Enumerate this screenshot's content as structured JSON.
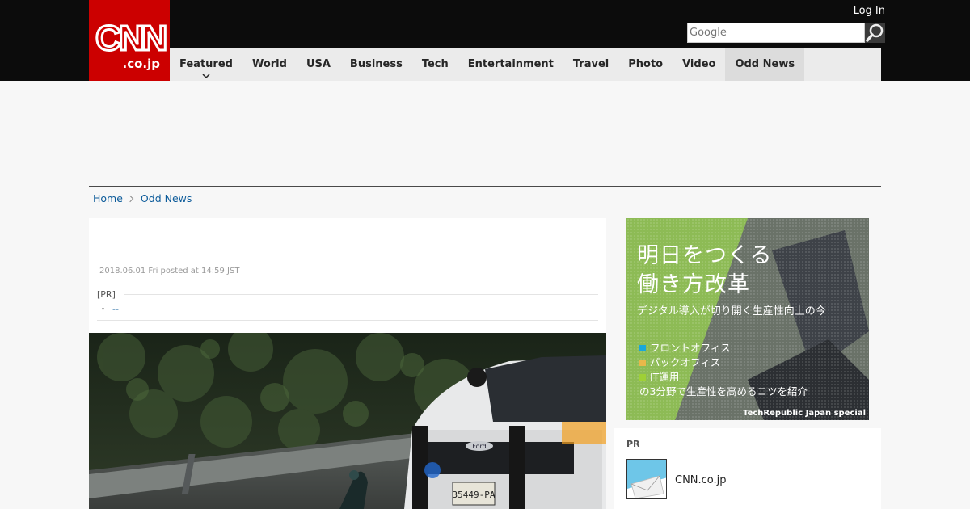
{
  "header": {
    "logo_text": "CNN",
    "logo_sub": ".co.jp",
    "login_label": "Log In",
    "search_placeholder": "Google"
  },
  "nav": {
    "items": [
      {
        "label": "Featured"
      },
      {
        "label": "World"
      },
      {
        "label": "USA"
      },
      {
        "label": "Business"
      },
      {
        "label": "Tech"
      },
      {
        "label": "Entertainment"
      },
      {
        "label": "Travel"
      },
      {
        "label": "Photo"
      },
      {
        "label": "Video"
      },
      {
        "label": "Odd News"
      }
    ],
    "active": "Odd News"
  },
  "breadcrumb": {
    "home": "Home",
    "current": "Odd News"
  },
  "article": {
    "date": "2018.06.01 Fri posted at 14:59 JST",
    "pr_label": "[PR]",
    "pr_bullet": "・",
    "pr_link": "--"
  },
  "ad": {
    "title_line1": "明日をつくる",
    "title_line2": "働き方改革",
    "subtitle": "デジタル導入が切り開く生産性向上の今",
    "list": [
      "フロントオフィス",
      "バックオフィス",
      "IT運用"
    ],
    "list_footer": "の3分野で生産性を高めるコツを紹介",
    "credit": "TechRepublic Japan special",
    "colors": {
      "bg": "#8dbb55",
      "sq1": "#1aa7d9",
      "sq2": "#e8b84a",
      "sq3": "#9ed036"
    }
  },
  "prbox": {
    "label": "PR",
    "item_name": "CNN.co.jp"
  },
  "photo": {
    "plate_text": "35449-PA",
    "brand_text": "Ford"
  },
  "colors": {
    "brand_red": "#cc0000",
    "header_bg": "#0c0c0c",
    "link": "#0c5b9a"
  }
}
